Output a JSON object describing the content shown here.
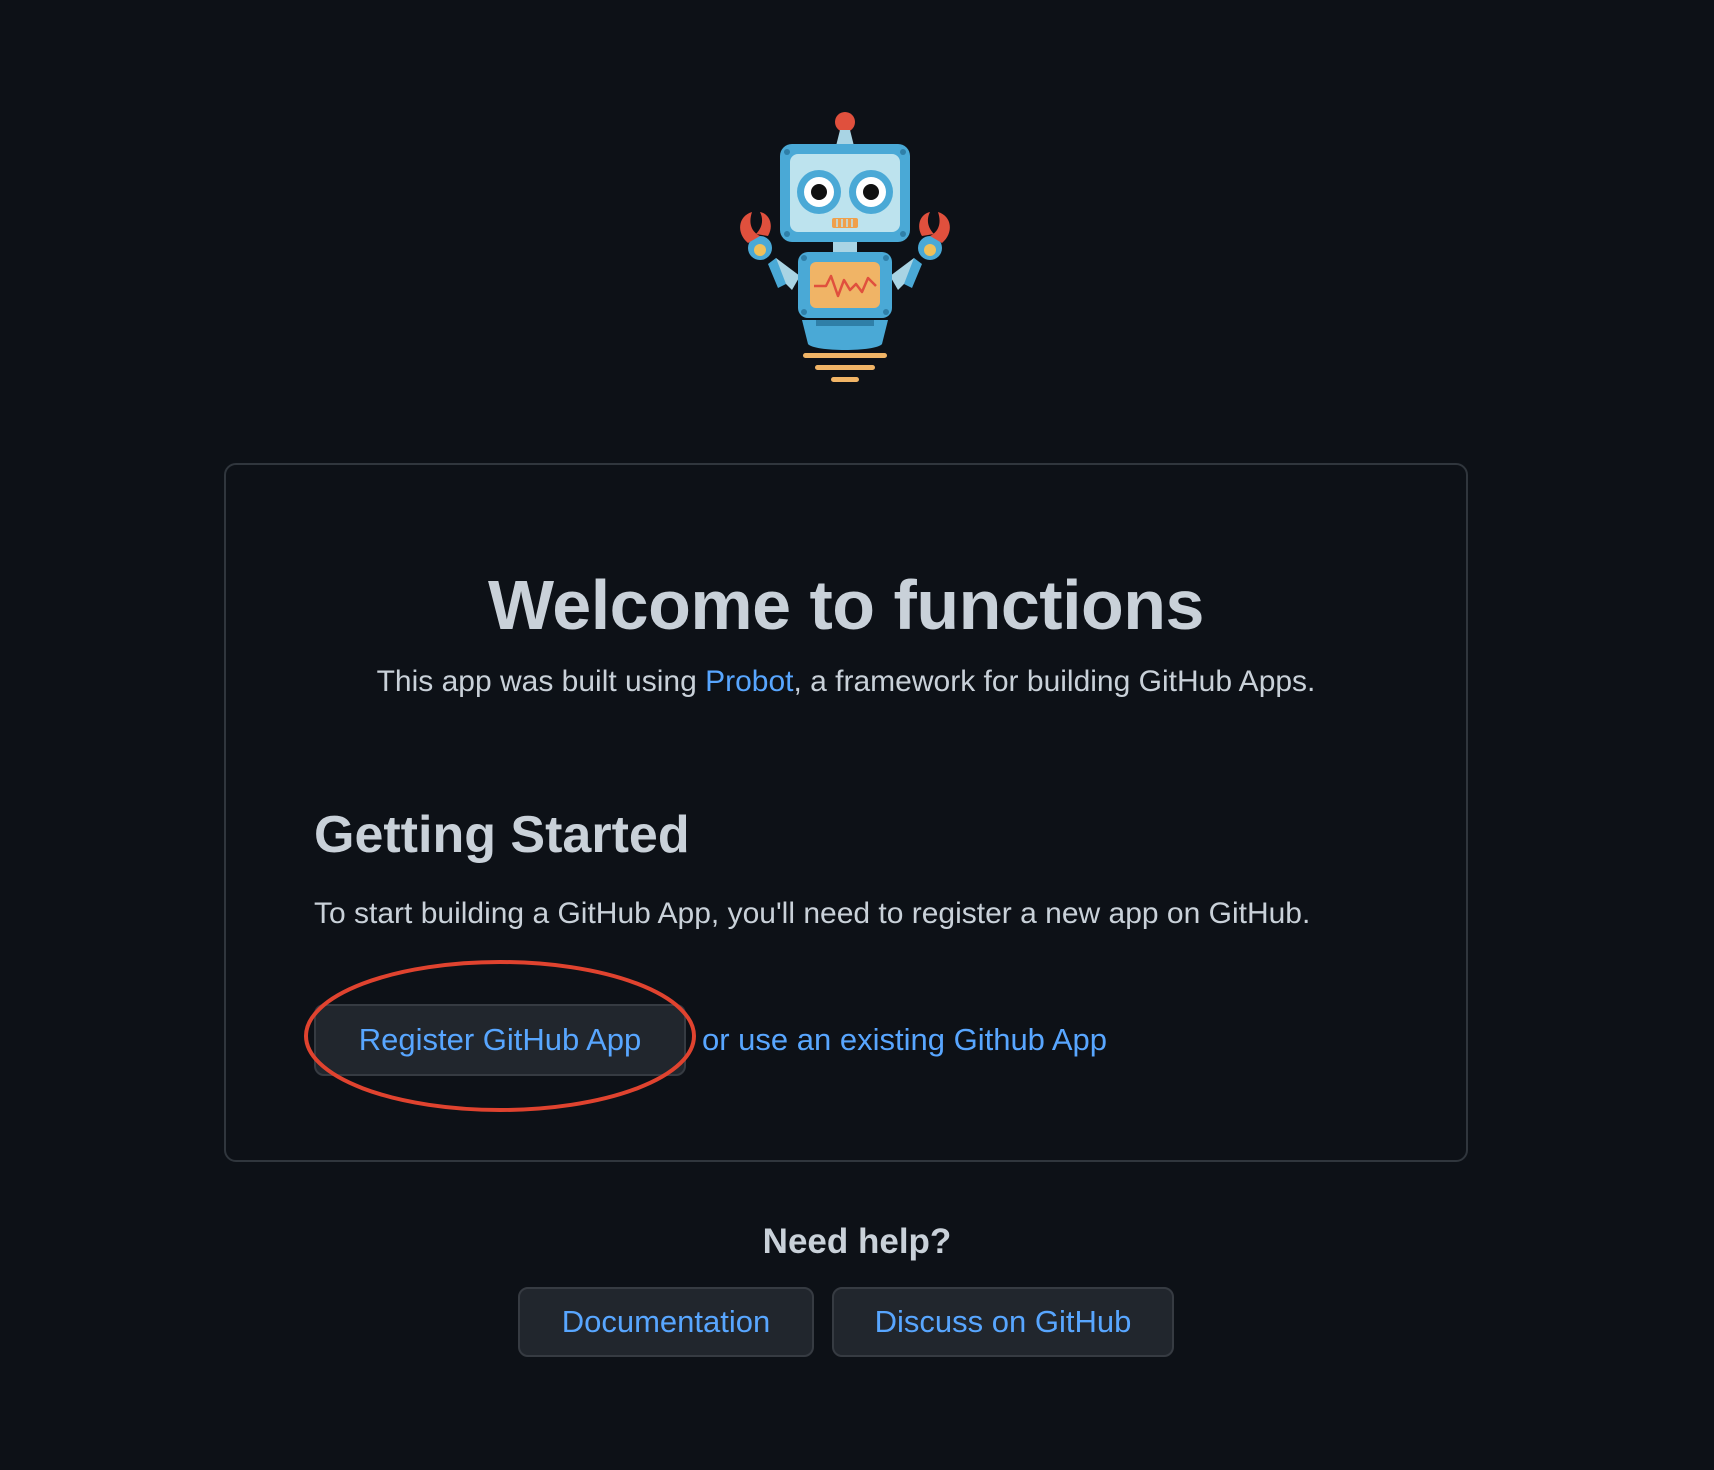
{
  "welcome": {
    "title": "Welcome to functions",
    "subtitle_prefix": "This app was built using ",
    "probot_link": "Probot",
    "subtitle_suffix": ", a framework for building GitHub Apps."
  },
  "getting_started": {
    "title": "Getting Started",
    "text": "To start building a GitHub App, you'll need to register a new app on GitHub.",
    "register_button": "Register GitHub App",
    "existing_link": "or use an existing Github App"
  },
  "help": {
    "title": "Need help?",
    "documentation_button": "Documentation",
    "discuss_button": "Discuss on GitHub"
  },
  "colors": {
    "background": "#0d1117",
    "link": "#58a6ff",
    "annotation": "#e0432f"
  },
  "icons": {
    "logo": "probot-robot-icon"
  }
}
